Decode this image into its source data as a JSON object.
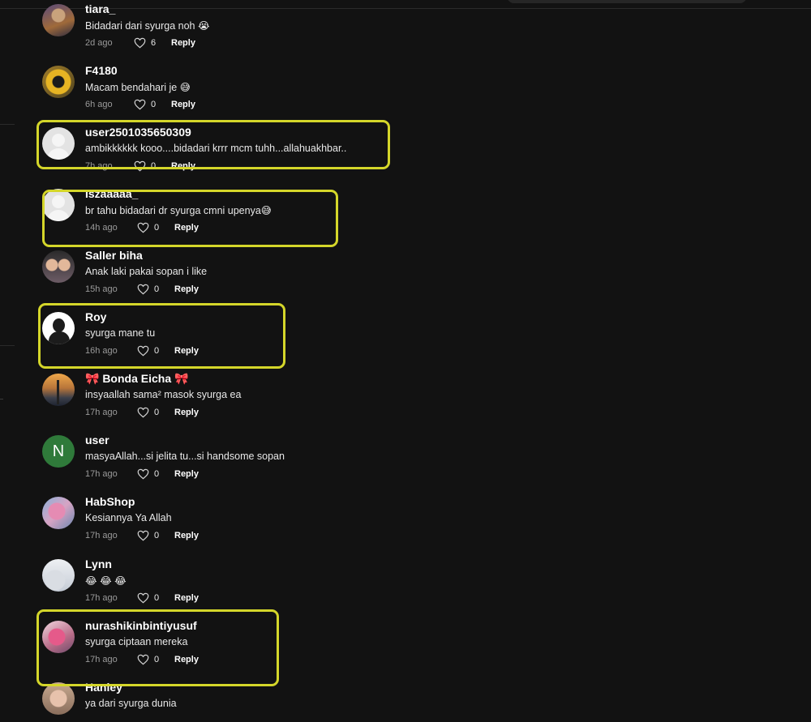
{
  "comments": [
    {
      "username": "tiara_",
      "text": "Bidadari dari syurga noh 😭",
      "time": "2d ago",
      "likes": "6",
      "reply": "Reply",
      "highlighted": false
    },
    {
      "username": "F4180",
      "text": "Macam bendahari je 😅",
      "time": "6h ago",
      "likes": "0",
      "reply": "Reply",
      "highlighted": false
    },
    {
      "username": "user2501035650309",
      "text": "ambikkkkkk kooo....bidadari krrr mcm tuhh...allahuakhbar..",
      "time": "7h ago",
      "likes": "0",
      "reply": "Reply",
      "highlighted": true
    },
    {
      "username": "Iszaaaaa_",
      "text": "br tahu bidadari dr syurga cmni upenya😅",
      "time": "14h ago",
      "likes": "0",
      "reply": "Reply",
      "highlighted": true
    },
    {
      "username": "Saller biha",
      "text": "Anak laki pakai sopan i like",
      "time": "15h ago",
      "likes": "0",
      "reply": "Reply",
      "highlighted": false
    },
    {
      "username": "Roy",
      "text": "syurga mane tu",
      "time": "16h ago",
      "likes": "0",
      "reply": "Reply",
      "highlighted": true
    },
    {
      "username": "🎀 Bonda Eicha 🎀",
      "text": "insyaallah sama² masok syurga ea",
      "time": "17h ago",
      "likes": "0",
      "reply": "Reply",
      "highlighted": false
    },
    {
      "username": "user",
      "avatar_letter": "N",
      "text": "masyaAllah...si jelita tu...si handsome sopan",
      "time": "17h ago",
      "likes": "0",
      "reply": "Reply",
      "highlighted": false
    },
    {
      "username": "HabShop",
      "text": "Kesiannya Ya Allah",
      "time": "17h ago",
      "likes": "0",
      "reply": "Reply",
      "highlighted": false
    },
    {
      "username": "Lynn",
      "text": "😂 😂 😂",
      "time": "17h ago",
      "likes": "0",
      "reply": "Reply",
      "highlighted": false
    },
    {
      "username": "nurashikinbintiyusuf",
      "text": "syurga ciptaan mereka",
      "time": "17h ago",
      "likes": "0",
      "reply": "Reply",
      "highlighted": true
    },
    {
      "username": "Haniey",
      "text": "ya dari syurga dunia",
      "highlighted": false
    }
  ],
  "colors": {
    "background": "#121212",
    "highlight": "#d4d62a",
    "secondary_text": "#9a9a9a"
  }
}
